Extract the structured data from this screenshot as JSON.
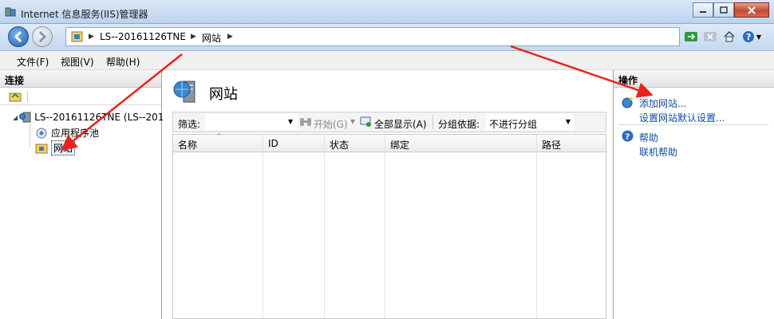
{
  "window": {
    "title": "Internet 信息服务(IIS)管理器"
  },
  "address": {
    "crumbs": [
      "LS--20161126TNE",
      "网站"
    ]
  },
  "menu": {
    "file": "文件(F)",
    "view": "视图(V)",
    "help": "帮助(H)"
  },
  "left": {
    "header": "连接",
    "tree": {
      "server": "LS--20161126TNE (LS--201",
      "app_pools": "应用程序池",
      "sites": "网站"
    }
  },
  "center": {
    "title": "网站",
    "filter_label": "筛选:",
    "start_label": "开始(G)",
    "show_all_label": "全部显示(A)",
    "group_by_label": "分组依据:",
    "group_value": "不进行分组",
    "columns": [
      "名称",
      "ID",
      "状态",
      "绑定",
      "路径"
    ]
  },
  "right": {
    "header": "操作",
    "add_site": "添加网站...",
    "set_defaults": "设置网站默认设置...",
    "help": "帮助",
    "online_help": "联机帮助"
  },
  "colors": {
    "accent_blue": "#0a4fa0",
    "arrow_red": "#e8231b"
  }
}
